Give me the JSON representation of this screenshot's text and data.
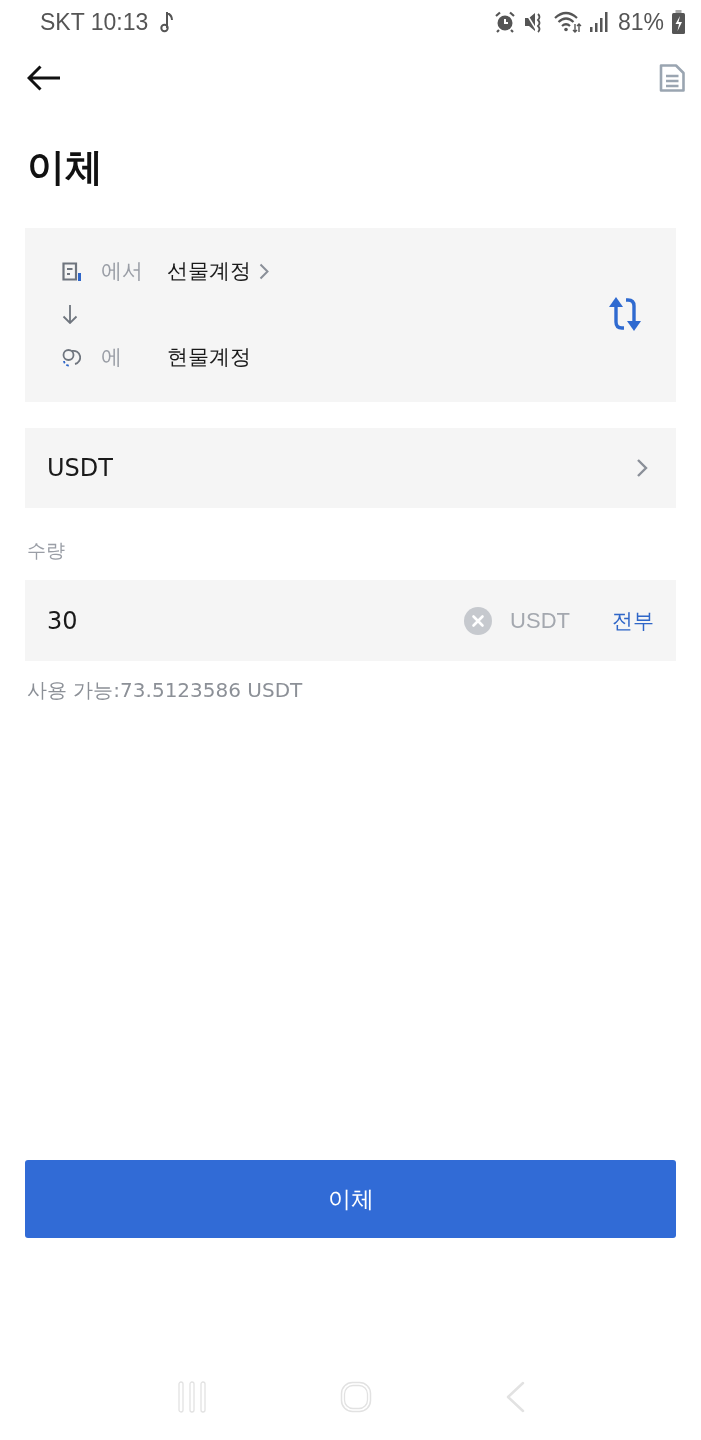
{
  "status_bar": {
    "carrier_time": "SKT 10:13",
    "battery": "81%"
  },
  "title": "이체",
  "transfer": {
    "from": {
      "label": "에서",
      "account": "선물계정"
    },
    "to": {
      "label": "에",
      "account": "현물계정"
    }
  },
  "coin": "USDT",
  "amount": {
    "label": "수량",
    "value": "30",
    "unit": "USDT",
    "all_button": "전부"
  },
  "available": "사용 가능:73.5123586 USDT",
  "submit_button": "이체"
}
